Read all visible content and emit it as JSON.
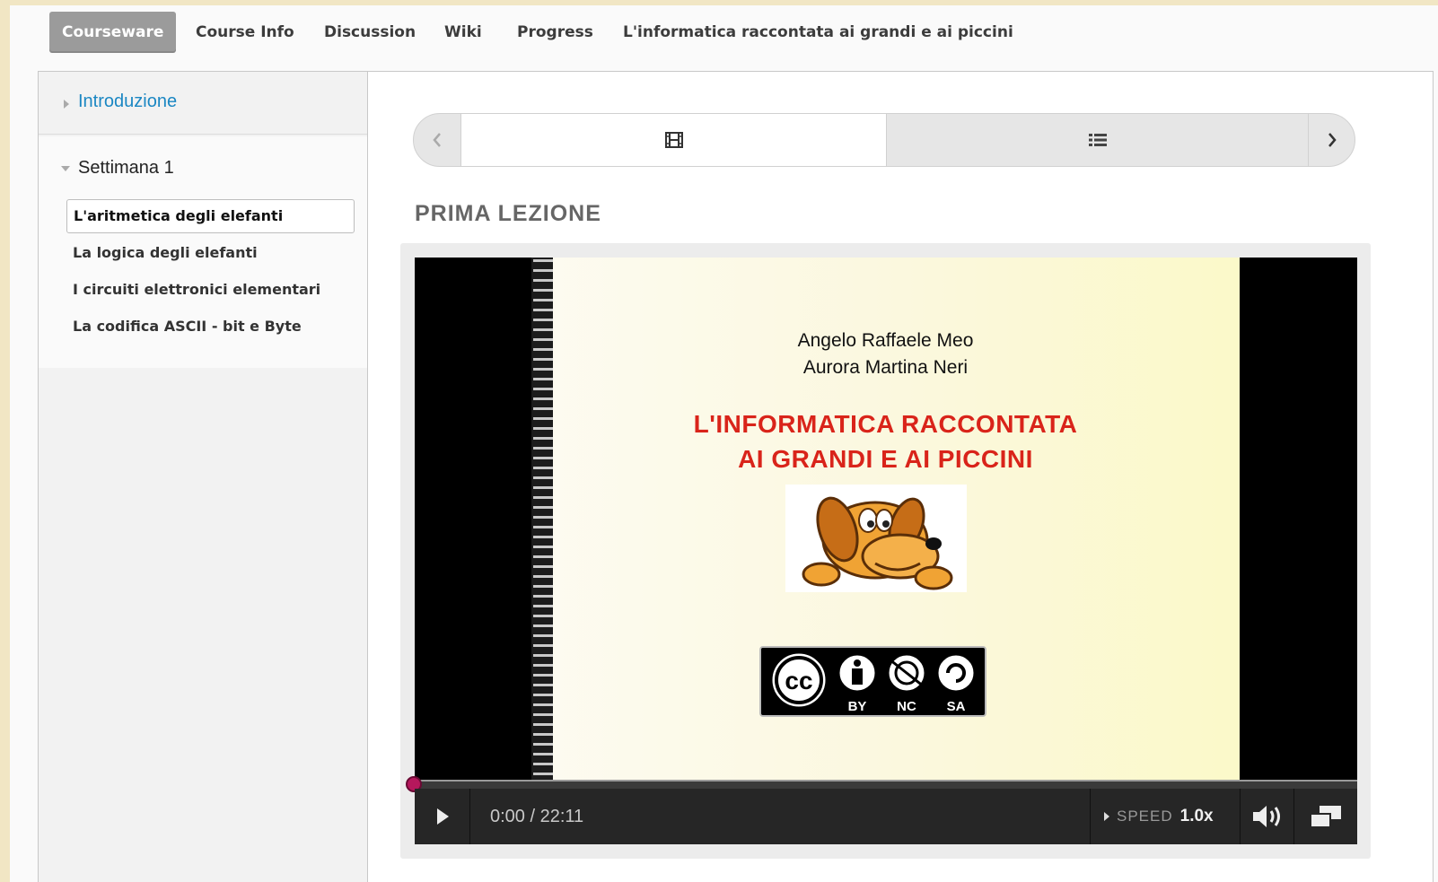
{
  "topnav": {
    "tabs": [
      {
        "label": "Courseware",
        "active": true
      },
      {
        "label": "Course Info"
      },
      {
        "label": "Discussion"
      },
      {
        "label": "Wiki"
      },
      {
        "label": "Progress"
      },
      {
        "label": "L'informatica raccontata ai grandi e ai piccini"
      }
    ]
  },
  "sidebar": {
    "chapters": [
      {
        "title": "Introduzione",
        "expanded": false,
        "link_color": "#1b87c3"
      },
      {
        "title": "Settimana 1",
        "expanded": true,
        "lessons": [
          {
            "label": "L'aritmetica degli elefanti",
            "active": true
          },
          {
            "label": "La logica degli elefanti"
          },
          {
            "label": "I circuiti elettronici elementari"
          },
          {
            "label": "La codifica ASCII - bit e Byte"
          }
        ]
      }
    ]
  },
  "sequence_nav": {
    "items": [
      {
        "icon": "film-icon",
        "active": true
      },
      {
        "icon": "list-icon"
      }
    ],
    "prev_icon": "chevron-left-icon",
    "next_icon": "chevron-right-icon"
  },
  "unit": {
    "title": "PRIMA LEZIONE"
  },
  "video": {
    "slide": {
      "authors": [
        "Angelo Raffaele Meo",
        "Aurora Martina Neri"
      ],
      "title_lines": [
        "L'INFORMATICA RACCONTATA",
        "AI GRANDI E AI PICCINI"
      ],
      "license_labels": [
        "BY",
        "NC",
        "SA"
      ],
      "title_color": "#d9241a"
    },
    "controls": {
      "time": "0:00 / 22:11",
      "speed_label": "SPEED",
      "speed_value": "1.0x",
      "progress_fraction": 0
    },
    "accent": "#b5185c"
  }
}
